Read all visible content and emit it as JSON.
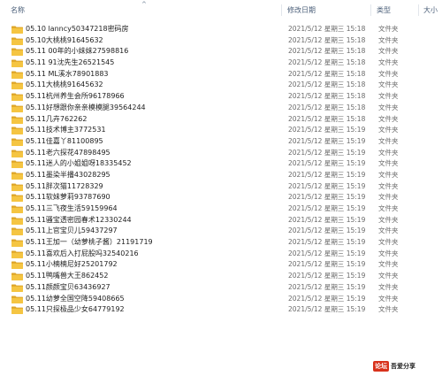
{
  "header": {
    "name_label": "名称",
    "sort_arrow": "^",
    "date_label": "修改日期",
    "type_label": "类型",
    "size_label": "大小"
  },
  "files": [
    {
      "name": "05.10 lanncy50347218密码房",
      "date": "2021/5/12 星期三 15:18",
      "type": "文件夹"
    },
    {
      "name": "05.10大桃桃91645632",
      "date": "2021/5/12 星期三 15:18",
      "type": "文件夹"
    },
    {
      "name": "05.11 00年的小妹妹27598816",
      "date": "2021/5/12 星期三 15:18",
      "type": "文件夹"
    },
    {
      "name": "05.11 91沈先生26521545",
      "date": "2021/5/12 星期三 15:18",
      "type": "文件夹"
    },
    {
      "name": "05.11 ML溪水78901883",
      "date": "2021/5/12 星期三 15:18",
      "type": "文件夹"
    },
    {
      "name": "05.11大桃桃91645632",
      "date": "2021/5/12 星期三 15:18",
      "type": "文件夹"
    },
    {
      "name": "05.11杭州养生会所96178966",
      "date": "2021/5/12 星期三 15:18",
      "type": "文件夹"
    },
    {
      "name": "05.11好想跟你亲亲模模腿39564244",
      "date": "2021/5/12 星期三 15:18",
      "type": "文件夹"
    },
    {
      "name": "05.11几卉762262",
      "date": "2021/5/12 星期三 15:18",
      "type": "文件夹"
    },
    {
      "name": "05.11技术博主3772531",
      "date": "2021/5/12 星期三 15:19",
      "type": "文件夹"
    },
    {
      "name": "05.11佳嘉丫81100895",
      "date": "2021/5/12 星期三 15:19",
      "type": "文件夹"
    },
    {
      "name": "05.11老六探花47898495",
      "date": "2021/5/12 星期三 15:19",
      "type": "文件夹"
    },
    {
      "name": "05.11迷人的小姐姐呀18335452",
      "date": "2021/5/12 星期三 15:19",
      "type": "文件夹"
    },
    {
      "name": "05.11墨染半播43028295",
      "date": "2021/5/12 星期三 15:19",
      "type": "文件夹"
    },
    {
      "name": "05.11胖次猫11728329",
      "date": "2021/5/12 星期三 15:19",
      "type": "文件夹"
    },
    {
      "name": "05.11软妹萝莉93787690",
      "date": "2021/5/12 星期三 15:19",
      "type": "文件夹"
    },
    {
      "name": "05.11三飞夜生活59159964",
      "date": "2021/5/12 星期三 15:19",
      "type": "文件夹"
    },
    {
      "name": "05.11骚宝透密园春术12330244",
      "date": "2021/5/12 星期三 15:19",
      "type": "文件夹"
    },
    {
      "name": "05.11上官宝贝儿59437297",
      "date": "2021/5/12 星期三 15:19",
      "type": "文件夹"
    },
    {
      "name": "05.11王加一（幼萝桃子酱）21191719",
      "date": "2021/5/12 星期三 15:19",
      "type": "文件夹"
    },
    {
      "name": "05.11喜欢后入打屁股吗32540216",
      "date": "2021/5/12 星期三 15:19",
      "type": "文件夹"
    },
    {
      "name": "05.11小楠楠尼好25201792",
      "date": "2021/5/12 星期三 15:19",
      "type": "文件夹"
    },
    {
      "name": "05.11鸭嘴兽大王862452",
      "date": "2021/5/12 星期三 15:19",
      "type": "文件夹"
    },
    {
      "name": "05.11颜颜宝贝63436927",
      "date": "2021/5/12 星期三 15:19",
      "type": "文件夹"
    },
    {
      "name": "05.11幼萝全国空降59408665",
      "date": "2021/5/12 星期三 15:19",
      "type": "文件夹"
    },
    {
      "name": "05.11只探极品少女64779192",
      "date": "2021/5/12 星期三 15:19",
      "type": "文件夹"
    }
  ],
  "watermark": {
    "box_text": "论坛",
    "text": "吾爱分享"
  },
  "colors": {
    "folder_yellow": "#f5c542",
    "folder_dark": "#dda427",
    "header_text": "#4c607a"
  },
  "icons": {
    "folder": "folder-icon",
    "sort": "sort-ascending-icon"
  }
}
